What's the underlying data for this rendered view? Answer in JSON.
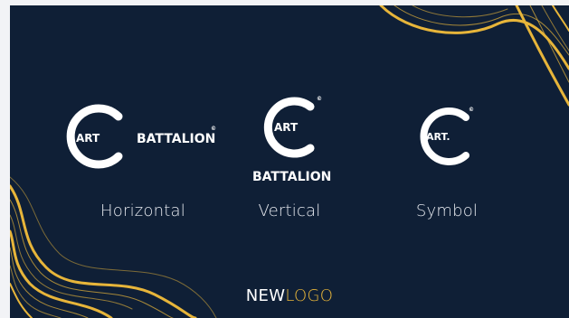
{
  "brand": {
    "mark_word": "ART",
    "mark_word_symbol": "ART.",
    "wordmark": "BATTALION",
    "copyright": "©"
  },
  "variants": [
    {
      "label": "Horizontal"
    },
    {
      "label": "Vertical"
    },
    {
      "label": "Symbol"
    }
  ],
  "footer": {
    "prefix": "NEW",
    "highlight": "LOGO"
  },
  "colors": {
    "background": "#0f1f36",
    "accent": "#e7b53a",
    "text": "#ffffff"
  }
}
